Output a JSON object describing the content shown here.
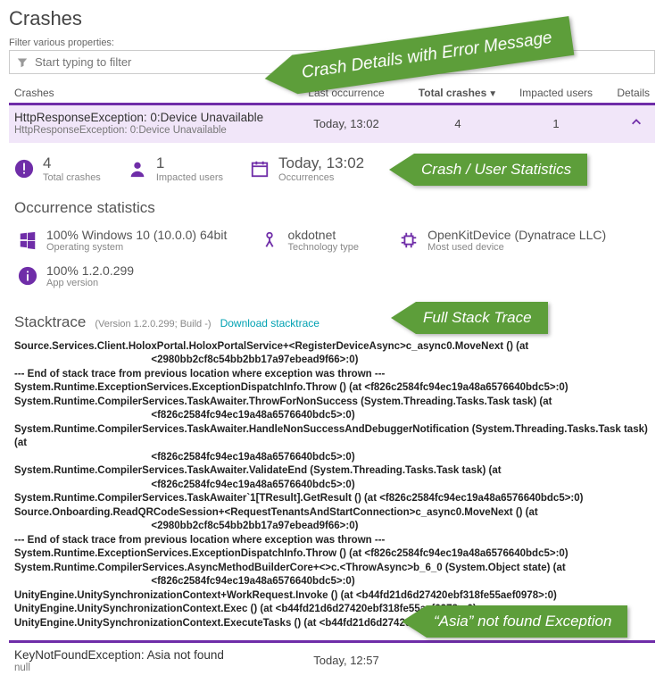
{
  "page_title": "Crashes",
  "filter": {
    "label": "Filter various properties:",
    "placeholder": "Start typing to filter"
  },
  "columns": {
    "crashes": "Crashes",
    "last": "Last occurrence",
    "total": "Total crashes",
    "impacted": "Impacted users",
    "details": "Details"
  },
  "row1": {
    "title": "HttpResponseException: 0:Device Unavailable",
    "subtitle": "HttpResponseException: 0:Device Unavailable",
    "last": "Today, 13:02",
    "total": "4",
    "impacted": "1"
  },
  "summary": {
    "total_value": "4",
    "total_label": "Total crashes",
    "imp_value": "1",
    "imp_label": "Impacted users",
    "occ_value": "Today, 13:02",
    "occ_label": "Occurrences"
  },
  "occurrence_title": "Occurrence statistics",
  "occ": {
    "os_value": "100% Windows 10 (10.0.0) 64bit",
    "os_label": "Operating system",
    "tech_value": "okdotnet",
    "tech_label": "Technology type",
    "device_value": "OpenKitDevice (Dynatrace LLC)",
    "device_label": "Most used device",
    "appver_value": "100% 1.2.0.299",
    "appver_label": "App version"
  },
  "stack": {
    "title": "Stacktrace",
    "meta": "(Version 1.2.0.299; Build -)",
    "download": "Download stacktrace",
    "text": "Source.Services.Client.HoloxPortal.HoloxPortalService+<RegisterDeviceAsync>c_async0.MoveNext () (at\n                                                <2980bb2cf8c54bb2bb17a97ebead9f66>:0)\n--- End of stack trace from previous location where exception was thrown ---\nSystem.Runtime.ExceptionServices.ExceptionDispatchInfo.Throw () (at <f826c2584fc94ec19a48a6576640bdc5>:0)\nSystem.Runtime.CompilerServices.TaskAwaiter.ThrowForNonSuccess (System.Threading.Tasks.Task task) (at\n                                                <f826c2584fc94ec19a48a6576640bdc5>:0)\nSystem.Runtime.CompilerServices.TaskAwaiter.HandleNonSuccessAndDebuggerNotification (System.Threading.Tasks.Task task) (at\n                                                <f826c2584fc94ec19a48a6576640bdc5>:0)\nSystem.Runtime.CompilerServices.TaskAwaiter.ValidateEnd (System.Threading.Tasks.Task task) (at\n                                                <f826c2584fc94ec19a48a6576640bdc5>:0)\nSystem.Runtime.CompilerServices.TaskAwaiter`1[TResult].GetResult () (at <f826c2584fc94ec19a48a6576640bdc5>:0)\nSource.Onboarding.ReadQRCodeSession+<RequestTenantsAndStartConnection>c_async0.MoveNext () (at\n                                                <2980bb2cf8c54bb2bb17a97ebead9f66>:0)\n--- End of stack trace from previous location where exception was thrown ---\nSystem.Runtime.ExceptionServices.ExceptionDispatchInfo.Throw () (at <f826c2584fc94ec19a48a6576640bdc5>:0)\nSystem.Runtime.CompilerServices.AsyncMethodBuilderCore+<>c.<ThrowAsync>b_6_0 (System.Object state) (at\n                                                <f826c2584fc94ec19a48a6576640bdc5>:0)\nUnityEngine.UnitySynchronizationContext+WorkRequest.Invoke () (at <b44fd21d6d27420ebf318fe55aef0978>:0)\nUnityEngine.UnitySynchronizationContext.Exec () (at <b44fd21d6d27420ebf318fe55aef0978>:0)\nUnityEngine.UnitySynchronizationContext.ExecuteTasks () (at <b44fd21d6d27420ebf318fe55aef0978>:0)"
  },
  "row2": {
    "title": "KeyNotFoundException: Asia not found",
    "subtitle": "null",
    "last": "Today, 12:57"
  },
  "annotations": {
    "a1": "Crash Details with Error Message",
    "a2": "Crash / User Statistics",
    "a3": "Full Stack Trace",
    "a4": "“Asia” not found Exception"
  }
}
